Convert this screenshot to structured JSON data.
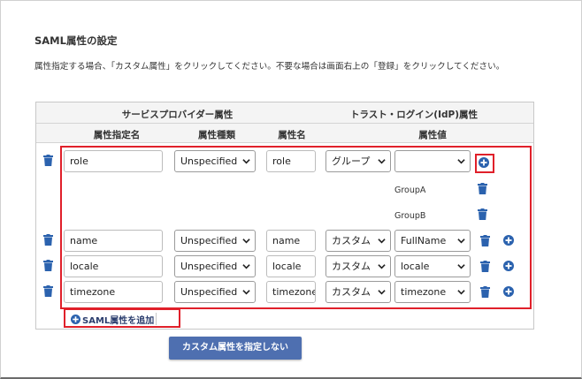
{
  "section": {
    "title": "SAML属性の設定",
    "description": "属性指定する場合、「カスタム属性」をクリックしてください。不要な場合は画面右上の「登録」をクリックしてください。"
  },
  "table": {
    "group_headers": {
      "sp": "サービスプロバイダー属性",
      "idp": "トラスト・ログイン(IdP)属性"
    },
    "col_headers": {
      "attr_name_spec": "属性指定名",
      "attr_type": "属性種類",
      "attr_name": "属性名",
      "attr_value": "属性値"
    },
    "rows": [
      {
        "name_spec": "role",
        "type": "Unspecified",
        "attr_name": "role",
        "source": "グループ",
        "value": "",
        "group_values": [
          "GroupA",
          "GroupB"
        ]
      },
      {
        "name_spec": "name",
        "type": "Unspecified",
        "attr_name": "name",
        "source": "カスタム",
        "value": "FullName"
      },
      {
        "name_spec": "locale",
        "type": "Unspecified",
        "attr_name": "locale",
        "source": "カスタム",
        "value": "locale"
      },
      {
        "name_spec": "timezone",
        "type": "Unspecified",
        "attr_name": "timezone",
        "source": "カスタム",
        "value": "timezone"
      }
    ]
  },
  "buttons": {
    "add_saml_attr": "SAML属性を追加",
    "no_custom_attr": "カスタム属性を指定しない"
  },
  "colors": {
    "accent": "#2b62ae",
    "highlight": "#e0202a",
    "primary_button": "#4e6fb0"
  },
  "icons": {
    "delete": "trash-icon",
    "add": "plus-circle-icon",
    "dropdown": "chevron-down-icon"
  }
}
